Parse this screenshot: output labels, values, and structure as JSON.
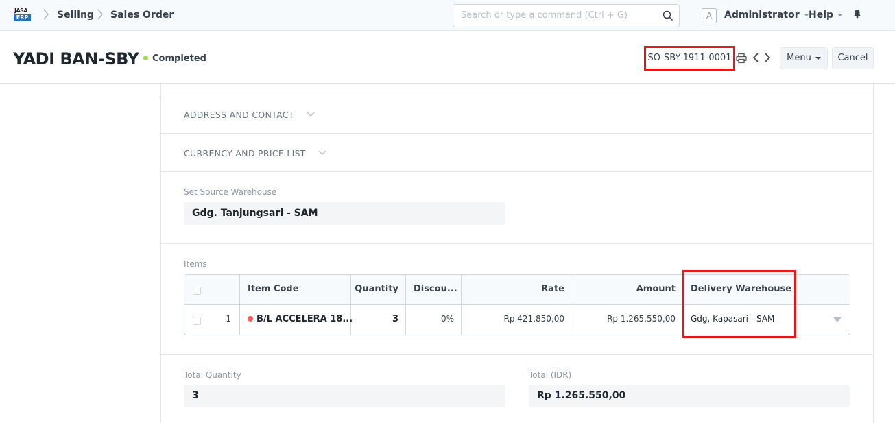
{
  "navbar": {
    "logo_top": "JASA",
    "logo_bottom": "ERP",
    "breadcrumbs": [
      "Selling",
      "Sales Order"
    ],
    "search_placeholder": "Search or type a command (Ctrl + G)",
    "avatar_letter": "A",
    "user_label": "Administrator",
    "help_label": "Help"
  },
  "page": {
    "title": "YADI BAN-SBY",
    "status": "Completed",
    "status_color": "#98d85b",
    "doc_name": "SO-SBY-1911-0001",
    "menu_label": "Menu",
    "cancel_label": "Cancel",
    "highlight_color": "#e01a1a"
  },
  "sections": {
    "address_contact": "ADDRESS AND CONTACT",
    "currency_price": "CURRENCY AND PRICE LIST"
  },
  "source_warehouse": {
    "label": "Set Source Warehouse",
    "value": "Gdg. Tanjungsari - SAM"
  },
  "items": {
    "label": "Items",
    "columns": {
      "item_code": "Item Code",
      "quantity": "Quantity",
      "discount": "Discou...",
      "rate": "Rate",
      "amount": "Amount",
      "delivery_warehouse": "Delivery Warehouse"
    },
    "rows": [
      {
        "idx": "1",
        "item_code": "B/L ACCELERA 18...",
        "quantity": "3",
        "discount": "0%",
        "rate": "Rp 421.850,00",
        "amount": "Rp 1.265.550,00",
        "delivery_warehouse": "Gdg. Kapasari - SAM"
      }
    ]
  },
  "totals": {
    "total_qty_label": "Total Quantity",
    "total_qty_value": "3",
    "total_label": "Total (IDR)",
    "total_value": "Rp 1.265.550,00"
  }
}
